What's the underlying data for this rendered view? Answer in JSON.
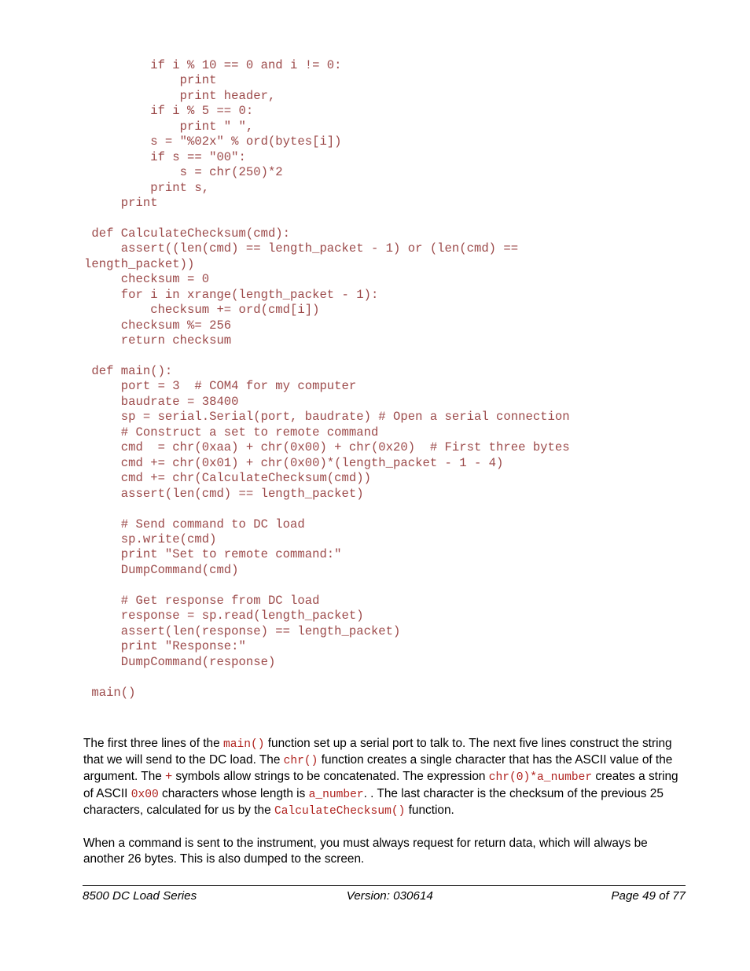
{
  "document": {
    "code_listing": [
      "         if i % 10 == 0 and i != 0:",
      "             print",
      "             print header,",
      "         if i % 5 == 0:",
      "             print \" \",",
      "         s = \"%02x\" % ord(bytes[i])",
      "         if s == \"00\":",
      "             s = chr(250)*2",
      "         print s,",
      "     print",
      "",
      " def CalculateChecksum(cmd):",
      "     assert((len(cmd) == length_packet - 1) or (len(cmd) ==",
      "length_packet))",
      "     checksum = 0",
      "     for i in xrange(length_packet - 1):",
      "         checksum += ord(cmd[i])",
      "     checksum %= 256",
      "     return checksum",
      "",
      " def main():",
      "     port = 3  # COM4 for my computer",
      "     baudrate = 38400",
      "     sp = serial.Serial(port, baudrate) # Open a serial connection",
      "     # Construct a set to remote command",
      "     cmd  = chr(0xaa) + chr(0x00) + chr(0x20)  # First three bytes",
      "     cmd += chr(0x01) + chr(0x00)*(length_packet - 1 - 4)",
      "     cmd += chr(CalculateChecksum(cmd))",
      "     assert(len(cmd) == length_packet)",
      "",
      "     # Send command to DC load",
      "     sp.write(cmd)",
      "     print \"Set to remote command:\"",
      "     DumpCommand(cmd)",
      "",
      "     # Get response from DC load",
      "     response = sp.read(length_packet)",
      "     assert(len(response) == length_packet)",
      "     print \"Response:\"",
      "     DumpCommand(response)",
      "",
      " main()"
    ],
    "paragraph_1": {
      "seg_1": "The first three lines of the ",
      "code_1": "main()",
      "seg_2": " function set up a serial port to talk to. The next five lines construct the string that we will send to the DC load.  The ",
      "code_2": "chr()",
      "seg_3": " function creates a single character that has the ASCII value of the argument.  The ",
      "plus_1": "+",
      "seg_4": " symbols allow strings to be concatenated.  The expression ",
      "code_3": "chr(0)*a_number",
      "seg_5": "  creates a string of ASCII ",
      "code_4": "0x00",
      "seg_6": " characters whose length is ",
      "code_5": "a_number",
      "seg_7": ". .  The last character is the checksum of the previous 25 characters, calculated for us by the ",
      "code_6": "CalculateChecksum()",
      "seg_8": " function."
    },
    "paragraph_2": {
      "text": "When a command is sent to the instrument, you must always request for return data, which will always be another 26 bytes.  This is also dumped to the screen."
    },
    "footer": {
      "left": "8500 DC Load Series",
      "center": "Version:  030614",
      "right": "Page 49 of 77"
    },
    "colors": {
      "code_block": "#9c4a4a",
      "inline_code": "#b0231f",
      "body_text": "#000000",
      "page_background": "#ffffff"
    }
  }
}
